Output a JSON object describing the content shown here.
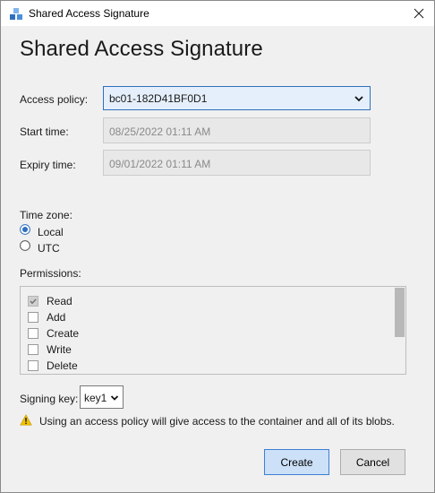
{
  "window": {
    "title": "Shared Access Signature",
    "app_icon": "blob-container-icon",
    "close_icon": "close-icon"
  },
  "heading": "Shared Access Signature",
  "access_policy": {
    "label": "Access policy:",
    "value": "bc01-182D41BF0D1",
    "icon": "chevron-down-icon"
  },
  "start_time": {
    "label": "Start time:",
    "value": "08/25/2022 01:11 AM"
  },
  "expiry_time": {
    "label": "Expiry time:",
    "value": "09/01/2022 01:11 AM"
  },
  "time_zone": {
    "label": "Time zone:",
    "options": [
      {
        "label": "Local",
        "selected": true
      },
      {
        "label": "UTC",
        "selected": false
      }
    ]
  },
  "permissions": {
    "label": "Permissions:",
    "items": [
      {
        "label": "Read",
        "checked": true,
        "disabled": true
      },
      {
        "label": "Add",
        "checked": false
      },
      {
        "label": "Create",
        "checked": false
      },
      {
        "label": "Write",
        "checked": false
      },
      {
        "label": "Delete",
        "checked": false
      }
    ]
  },
  "signing_key": {
    "label": "Signing key:",
    "value": "key1",
    "icon": "chevron-down-icon"
  },
  "warning": {
    "icon": "warning-icon",
    "text": "Using an access policy will give access to the container and all of its blobs."
  },
  "buttons": {
    "create": "Create",
    "cancel": "Cancel"
  },
  "colors": {
    "dialog_bg": "#f0f0f0",
    "accent": "#2f6fbf",
    "primary_button_bg": "#cce0f7",
    "warning": "#f2c200"
  }
}
